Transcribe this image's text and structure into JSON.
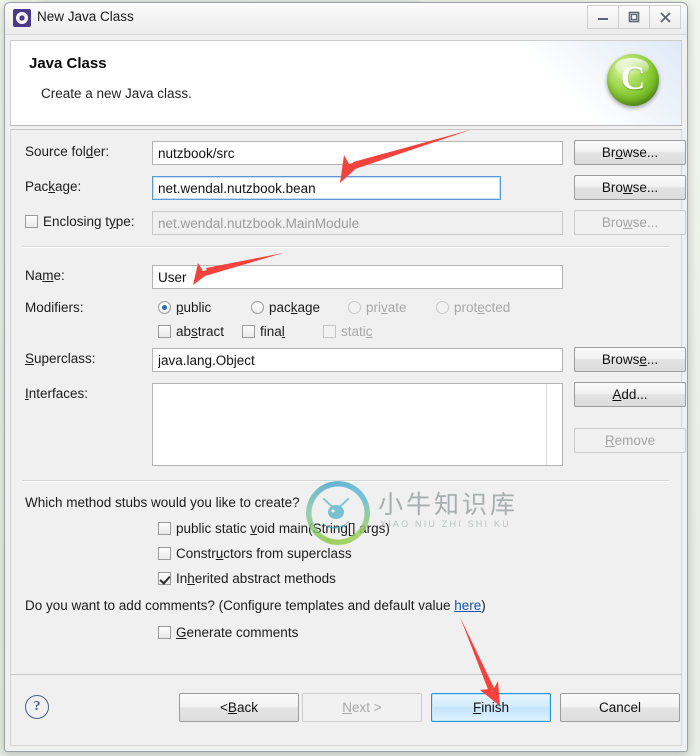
{
  "window": {
    "title": "New Java Class",
    "icon": "java-class-wizard-icon",
    "controls": {
      "minimize": "minimize-icon",
      "maximize": "maximize-icon",
      "close": "close-icon"
    }
  },
  "header": {
    "title": "Java Class",
    "description": "Create a new Java class.",
    "logo_glyph": "C"
  },
  "form": {
    "source_folder": {
      "label_pre": "Source fol",
      "label_mn": "d",
      "label_post": "er:",
      "value": "nutzbook/src",
      "browse": {
        "pre": "Br",
        "mn": "o",
        "post": "wse..."
      }
    },
    "package": {
      "label_pre": "Pac",
      "label_mn": "k",
      "label_post": "age:",
      "value": "net.wendal.nutzbook.bean",
      "browse": {
        "pre": "Bro",
        "mn": "w",
        "post": "se..."
      }
    },
    "enclosing_type": {
      "label_pre": "Enclosing t",
      "label_mn": "y",
      "label_post": "pe:",
      "checked": false,
      "value": "net.wendal.nutzbook.MainModule",
      "disabled": true,
      "browse": {
        "pre": "Bro",
        "mn": "w",
        "post": "se..."
      }
    },
    "name": {
      "label_pre": "Na",
      "label_mn": "m",
      "label_post": "e:",
      "value": "User"
    },
    "modifiers": {
      "label": "Modifiers:",
      "radios": [
        {
          "pre": "",
          "mn": "p",
          "post": "ublic",
          "checked": true,
          "disabled": false
        },
        {
          "pre": "pac",
          "mn": "k",
          "post": "age",
          "checked": false,
          "disabled": false
        },
        {
          "pre": "pri",
          "mn": "v",
          "post": "ate",
          "checked": false,
          "disabled": true
        },
        {
          "pre": "prot",
          "mn": "e",
          "post": "cted",
          "checked": false,
          "disabled": true
        }
      ],
      "checks": [
        {
          "pre": "ab",
          "mn": "s",
          "post": "tract",
          "checked": false,
          "disabled": false
        },
        {
          "pre": "fina",
          "mn": "l",
          "post": "",
          "checked": false,
          "disabled": false
        },
        {
          "pre": "stati",
          "mn": "c",
          "post": "",
          "checked": false,
          "disabled": true
        }
      ]
    },
    "superclass": {
      "label_pre": "",
      "label_mn": "S",
      "label_post": "uperclass:",
      "value": "java.lang.Object",
      "browse": {
        "pre": "Brows",
        "mn": "e",
        "post": "..."
      }
    },
    "interfaces": {
      "label_pre": "",
      "label_mn": "I",
      "label_post": "nterfaces:",
      "items": [],
      "add": {
        "pre": "",
        "mn": "A",
        "post": "dd..."
      },
      "remove": {
        "pre": "",
        "mn": "R",
        "post": "emove"
      },
      "remove_disabled": true
    }
  },
  "stubs": {
    "question": "Which method stubs would you like to create?",
    "items": [
      {
        "pre": "public static ",
        "mn": "v",
        "post": "oid main(String[] args)",
        "checked": false
      },
      {
        "pre": "Constr",
        "mn": "u",
        "post": "ctors from superclass",
        "checked": false
      },
      {
        "pre": "In",
        "mn": "h",
        "post": "erited abstract methods",
        "checked": true
      }
    ]
  },
  "comments": {
    "question_pre": "Do you want to add comments? (Configure templates and default value ",
    "link": "here",
    "question_post": ")",
    "item": {
      "pre": "",
      "mn": "G",
      "post": "enerate comments",
      "checked": false
    }
  },
  "footer": {
    "help": "?",
    "back": {
      "pre": "< ",
      "mn": "B",
      "post": "ack"
    },
    "next": {
      "pre": "",
      "mn": "N",
      "post": "ext >",
      "disabled": true
    },
    "finish": {
      "pre": "",
      "mn": "F",
      "post": "inish",
      "default": true
    },
    "cancel": {
      "pre": "Cancel",
      "mn": "",
      "post": ""
    }
  },
  "watermark": {
    "chinese": "小牛知识库",
    "pinyin": "XIAO NIU ZHI SHI KU"
  },
  "annotations": {
    "arrow_color": "#f4433c",
    "arrows": [
      {
        "name": "arrow-to-package-field"
      },
      {
        "name": "arrow-to-name-field"
      },
      {
        "name": "arrow-to-finish-button"
      }
    ]
  }
}
